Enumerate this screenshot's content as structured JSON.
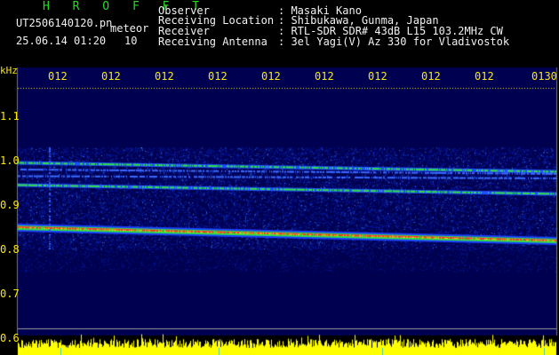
{
  "header": {
    "program": "H R O F F T",
    "filename": "UT2506140120.pn",
    "filename_suffix": "meteor",
    "datetime": "25.06.14 01:20",
    "interval": "10",
    "fields": [
      {
        "label": "Observer",
        "value": ": Masaki Kano"
      },
      {
        "label": "Receiving Location",
        "value": ": Shibukawa, Gunma, Japan"
      },
      {
        "label": "Receiver",
        "value": ": RTL-SDR SDR# 43dB L15 103.2MHz CW"
      },
      {
        "label": "Receiving Antenna",
        "value": ": 3el Yagi(V) Az 330 for Vladivostok"
      }
    ]
  },
  "chart_data": {
    "type": "heatmap",
    "ylabel": "kHz",
    "y_ticks": [
      "1.1",
      "1.0",
      "0.9",
      "0.8",
      "0.7",
      "0.6"
    ],
    "y_tick_values": [
      1.1,
      1.0,
      0.9,
      0.8,
      0.7,
      0.6
    ],
    "x_ticks": [
      "012",
      "012",
      "012",
      "012",
      "012",
      "012",
      "012",
      "012",
      "012",
      "0130"
    ],
    "ylim": [
      0.6,
      1.1
    ],
    "grid": false,
    "colors": {
      "strong": "#ff3030",
      "medium": "#30e040",
      "weak": "#2040ff",
      "background": "#000050",
      "amplitude": "#ffff00"
    },
    "lines": [
      {
        "freq_start": 0.85,
        "freq_end": 0.82,
        "intensity": "strong"
      },
      {
        "freq_start": 0.995,
        "freq_end": 0.975,
        "intensity": "medium"
      },
      {
        "freq_start": 0.945,
        "freq_end": 0.925,
        "intensity": "medium"
      },
      {
        "freq_start": 0.965,
        "freq_end": 0.96,
        "intensity": "weak"
      },
      {
        "freq_start": 0.98,
        "freq_end": 0.97,
        "intensity": "weak"
      }
    ],
    "noise_band": [
      0.8,
      1.03
    ]
  }
}
